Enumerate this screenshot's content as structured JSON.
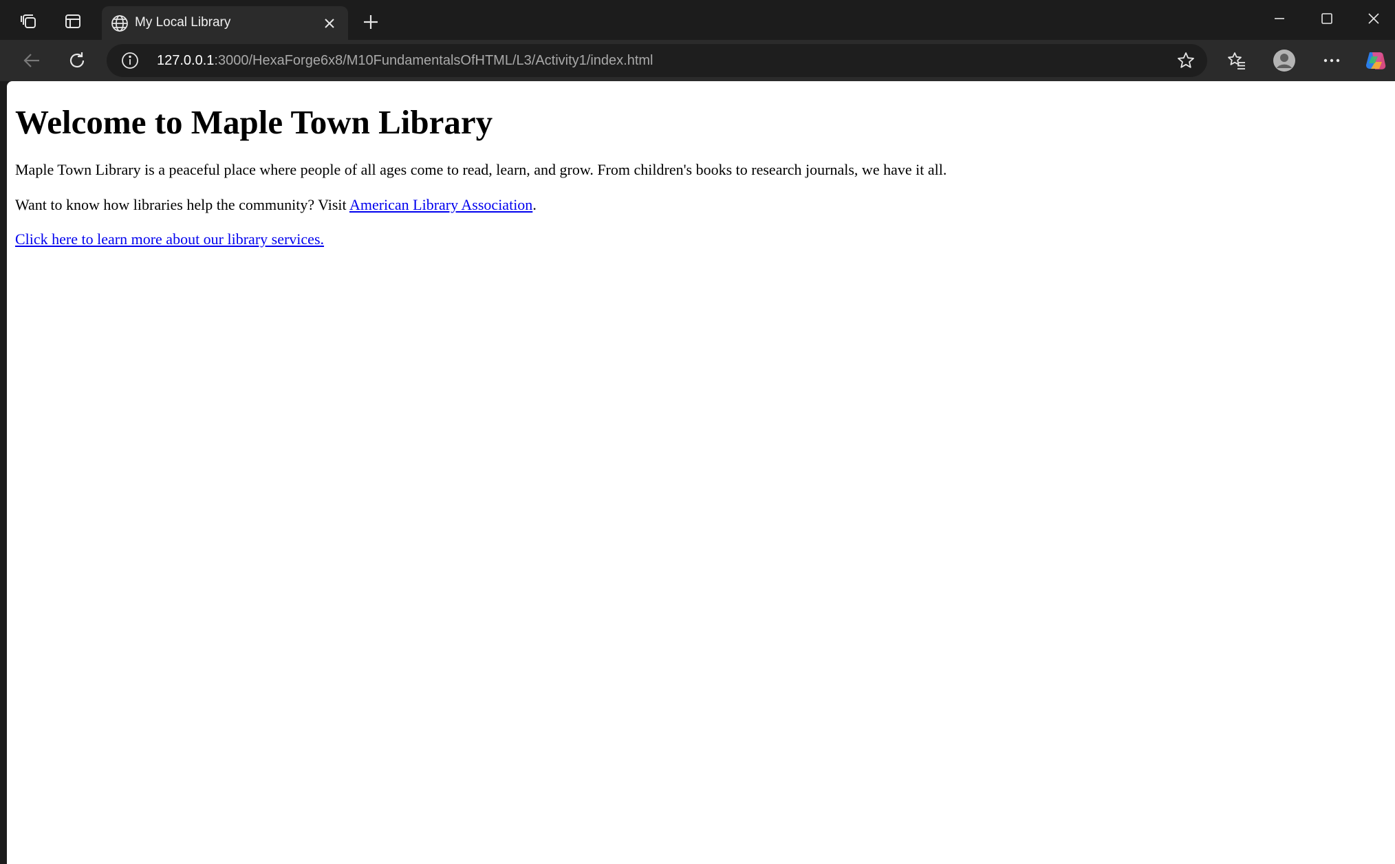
{
  "browser": {
    "tab": {
      "title": "My Local Library",
      "favicon": "globe-icon"
    },
    "address_bar": {
      "host": "127.0.0.1",
      "path": ":3000/HexaForge6x8/M10FundamentalsOfHTML/L3/Activity1/index.html"
    },
    "icons": {
      "workspaces": "workspaces-icon",
      "tab_actions": "tab-actions-icon",
      "close_tab": "close-icon",
      "new_tab": "plus-icon",
      "minimize": "minimize-icon",
      "maximize": "maximize-icon",
      "close_window": "close-window-icon",
      "back": "back-arrow-icon",
      "refresh": "refresh-icon",
      "site_info": "info-icon",
      "favorite": "star-icon",
      "favorites": "favorites-icon",
      "profile": "profile-icon",
      "menu": "more-icon",
      "copilot": "copilot-icon"
    }
  },
  "page": {
    "heading": "Welcome to Maple Town Library",
    "intro": "Maple Town Library is a peaceful place where people of all ages come to read, learn, and grow. From children's books to research journals, we have it all.",
    "community_text": "Want to know how libraries help the community? Visit ",
    "ala_link": "American Library Association",
    "community_suffix": ".",
    "services_link": "Click here to learn more about our library services."
  },
  "colors": {
    "link": "#0000ee",
    "chrome_dark": "#1c1c1c",
    "chrome_toolbar": "#2b2b2b"
  }
}
